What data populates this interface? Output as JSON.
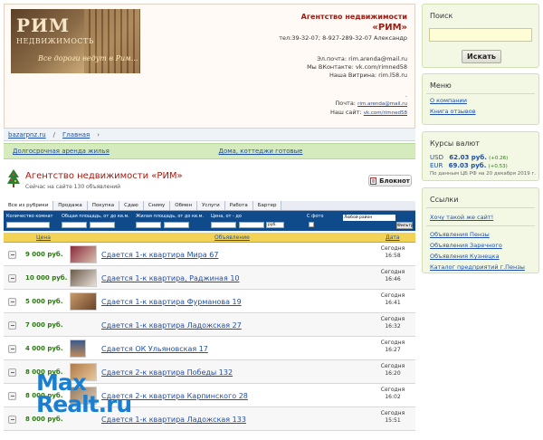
{
  "header": {
    "logo_title": "РИМ",
    "logo_subtitle": "НЕДВИЖИМОСТЬ",
    "logo_slogan": "Все дороги ведут в Рим...",
    "agency_name_line1": "Агентство недвижимости",
    "agency_name_line2": "«РИМ»",
    "phone": "тел:39-32-07; 8-927-289-32-07 Александр",
    "email_line": "Эл.почта: rim.arenda@mail.ru",
    "vk_line": "Мы ВКонтакте: vk.com/rimned58",
    "showcase_line": "Наша Витрина: rim.l58.ru",
    "dot": ".",
    "mail_label": "Почта:",
    "mail_value": "rim.arenda@mail.ru",
    "site_label": "Наш сайт:",
    "site_value": "vk.com/rimned58"
  },
  "breadcrumb": {
    "root": "bazarpnz.ru",
    "sep": "/",
    "home": "Главная",
    "arrow": "›"
  },
  "categories": [
    "Долгосрочная аренда жилья",
    "Дома, коттеджи готовые"
  ],
  "agency": {
    "title": "Агентство недвижимости «РИМ»",
    "count": "Сейчас на сайте 130 объявлений",
    "notebook": "Блокнот"
  },
  "tabs": [
    "Все из рубрики",
    "Продажа",
    "Покупка",
    "Сдаю",
    "Сниму",
    "Обмен",
    "Услуги",
    "Работа",
    "Бартер"
  ],
  "filters": {
    "rooms": "Количество комнат",
    "area": "Общая площадь, от до кв.м.",
    "living": "Жилая площадь, от до кв.м.",
    "price": "Цена, от - до",
    "photo": "С фото",
    "district": "Любой район",
    "currency": "руб.",
    "submit": "Фильтр"
  },
  "list_header": {
    "price": "Цена",
    "ad": "Объявление",
    "date": "Дата"
  },
  "listings": [
    {
      "price": "9 000 руб.",
      "title": "Сдается 1-к квартира Мира 67",
      "day": "Сегодня",
      "time": "16:58"
    },
    {
      "price": "10 000 руб.",
      "title": "Сдается 1-к квартира, Раджиная 10",
      "day": "Сегодня",
      "time": "16:46"
    },
    {
      "price": "5 000 руб.",
      "title": "Сдается 1-к квартира Фурманова 19",
      "day": "Сегодня",
      "time": "16:41"
    },
    {
      "price": "7 000 руб.",
      "title": "Сдается 1-к квартира Ладожская 27",
      "day": "Сегодня",
      "time": "16:32"
    },
    {
      "price": "4 000 руб.",
      "title": "Сдается ОК Ульяновская 17",
      "day": "Сегодня",
      "time": "16:27"
    },
    {
      "price": "8 000 руб.",
      "title": "Сдается 2-к квартира Победы 132",
      "day": "Сегодня",
      "time": "16:20"
    },
    {
      "price": "8 000 руб.",
      "title": "Сдается 2-к квартира Карпинского 28",
      "day": "Сегодня",
      "time": "16:02"
    },
    {
      "price": "8 000 руб.",
      "title": "Сдается 1-к квартира Ладожская 133",
      "day": "Сегодня",
      "time": "15:51"
    }
  ],
  "watermark": {
    "line1": "Max",
    "line2": "Realt.ru"
  },
  "sidebar": {
    "search": {
      "title": "Поиск",
      "button": "Искать"
    },
    "menu": {
      "title": "Меню",
      "items": [
        "О компании",
        "Книга отзывов"
      ]
    },
    "currency": {
      "title": "Курсы валют",
      "rates": [
        {
          "code": "USD",
          "value": "62.03 руб.",
          "change": "(+0.26)"
        },
        {
          "code": "EUR",
          "value": "69.03 руб.",
          "change": "(+0.53)"
        }
      ],
      "note": "По данным ЦБ РФ на 20 декабря 2019 г."
    },
    "links": {
      "title": "Ссылки",
      "promo": "Хочу такой же сайт!",
      "items": [
        "Объявления Пензы",
        "Объявления Заречного",
        "Объявления Кузнецка",
        "Каталог предприятий г.Пензы"
      ]
    }
  }
}
